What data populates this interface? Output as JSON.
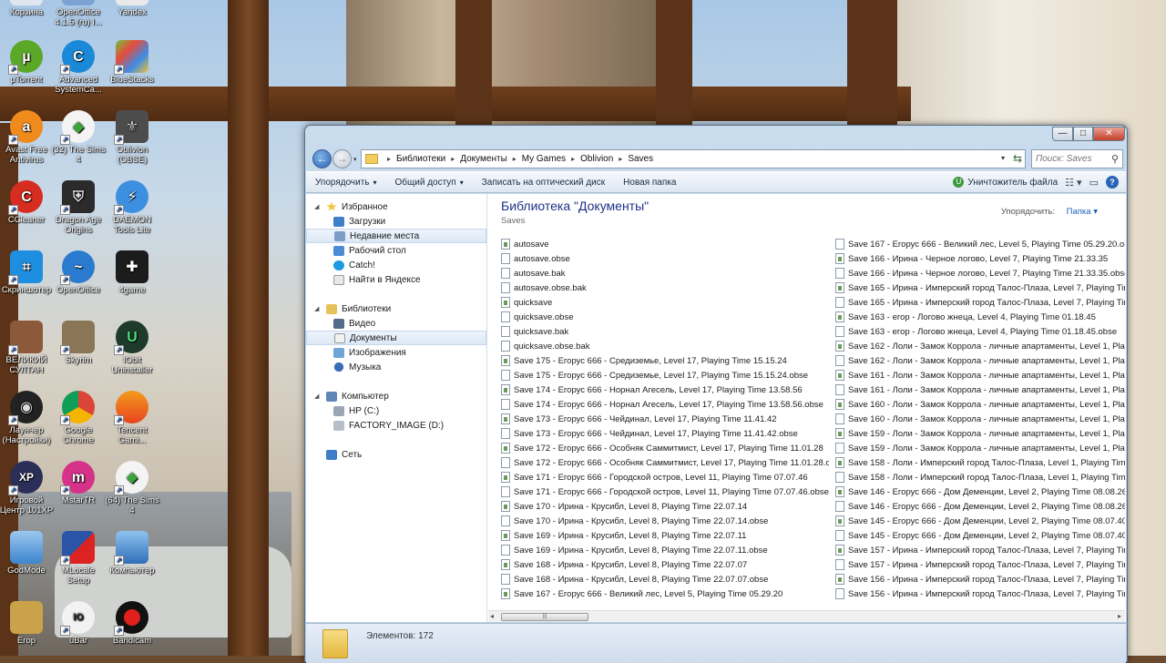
{
  "desktop": {
    "icons": [
      {
        "label": "Корзина"
      },
      {
        "label": "OpenOffice 4.1.5 (ru) I..."
      },
      {
        "label": "Yandex"
      },
      {
        "label": "µTorrent"
      },
      {
        "label": "Advanced SystemCa..."
      },
      {
        "label": "BlueStacks"
      },
      {
        "label": "Avast Free Antivirus"
      },
      {
        "label": "(32) The Sims 4"
      },
      {
        "label": "Oblivion (OBSE)"
      },
      {
        "label": "CCleaner"
      },
      {
        "label": "Dragon Age Origins"
      },
      {
        "label": "DAEMON Tools Lite"
      },
      {
        "label": "Скриншотер"
      },
      {
        "label": "OpenOffice"
      },
      {
        "label": "4game"
      },
      {
        "label": "ВЕЛИКИЙ СУЛТАН"
      },
      {
        "label": "Skyrim"
      },
      {
        "label": "IObit Uninstaller"
      },
      {
        "label": "Лаунчер (Настройки)"
      },
      {
        "label": "Google Chrome"
      },
      {
        "label": "Tencent Gami..."
      },
      {
        "label": "Игровой Центр 101XP"
      },
      {
        "label": "MstarTR"
      },
      {
        "label": "(64) The Sims 4"
      },
      {
        "label": "GodMode"
      },
      {
        "label": "MLocale Setup"
      },
      {
        "label": "Компьютер"
      },
      {
        "label": "Егор"
      },
      {
        "label": "uBar"
      },
      {
        "label": "Bandicam"
      }
    ]
  },
  "window": {
    "controls": {
      "minimize": "—",
      "maximize": "□",
      "close": "✕"
    },
    "address": {
      "crumbs": [
        "Библиотеки",
        "Документы",
        "My Games",
        "Oblivion",
        "Saves"
      ]
    },
    "search_placeholder": "Поиск: Saves",
    "toolbar": {
      "organize": "Упорядочить",
      "share": "Общий доступ",
      "burn": "Записать на оптический диск",
      "new_folder": "Новая папка",
      "delete_files": "Уничтожитель файла"
    },
    "nav": {
      "favorites": "Избранное",
      "downloads": "Загрузки",
      "recent": "Недавние места",
      "desktop": "Рабочий стол",
      "catch": "Catch!",
      "yandex": "Найти в Яндексе",
      "libraries": "Библиотеки",
      "video": "Видео",
      "documents": "Документы",
      "images": "Изображения",
      "music": "Музыка",
      "computer": "Компьютер",
      "drive_c": "HP (C:)",
      "drive_d": "FACTORY_IMAGE (D:)",
      "network": "Сеть"
    },
    "library": {
      "title": "Библиотека \"Документы\"",
      "subtitle": "Saves",
      "arrange_label": "Упорядочить:",
      "arrange_value": "Папка"
    },
    "files_col1": [
      {
        "name": "autosave",
        "save": true
      },
      {
        "name": "autosave.obse",
        "save": false
      },
      {
        "name": "autosave.bak",
        "save": false
      },
      {
        "name": "autosave.obse.bak",
        "save": false
      },
      {
        "name": "quicksave",
        "save": true
      },
      {
        "name": "quicksave.obse",
        "save": false
      },
      {
        "name": "quicksave.bak",
        "save": false
      },
      {
        "name": "quicksave.obse.bak",
        "save": false
      },
      {
        "name": "Save 175 - Егорус 666 - Средиземье, Level 17, Playing Time 15.15.24",
        "save": true
      },
      {
        "name": "Save 175 - Егорус 666 - Средиземье, Level 17, Playing Time 15.15.24.obse",
        "save": false
      },
      {
        "name": "Save 174 - Егорус 666 - Норнал Агесель, Level 17, Playing Time 13.58.56",
        "save": true
      },
      {
        "name": "Save 174 - Егорус 666 - Норнал Агесель, Level 17, Playing Time 13.58.56.obse",
        "save": false
      },
      {
        "name": "Save 173 - Егорус 666 - Чейдинал, Level 17, Playing Time 11.41.42",
        "save": true
      },
      {
        "name": "Save 173 - Егорус 666 - Чейдинал, Level 17, Playing Time 11.41.42.obse",
        "save": false
      },
      {
        "name": "Save 172 - Егорус 666 - Особняк Саммитмист, Level 17, Playing Time 11.01.28",
        "save": true
      },
      {
        "name": "Save 172 - Егорус 666 - Особняк Саммитмист, Level 17, Playing Time 11.01.28.obse",
        "save": false
      },
      {
        "name": "Save 171 - Егорус 666 - Городской остров, Level 11, Playing Time 07.07.46",
        "save": true
      },
      {
        "name": "Save 171 - Егорус 666 - Городской остров, Level 11, Playing Time 07.07.46.obse",
        "save": false
      },
      {
        "name": "Save 170 - Ирина - Крусибл, Level 8, Playing Time 22.07.14",
        "save": true
      },
      {
        "name": "Save 170 - Ирина - Крусибл, Level 8, Playing Time 22.07.14.obse",
        "save": false
      },
      {
        "name": "Save 169 - Ирина - Крусибл, Level 8, Playing Time 22.07.11",
        "save": true
      },
      {
        "name": "Save 169 - Ирина - Крусибл, Level 8, Playing Time 22.07.11.obse",
        "save": false
      },
      {
        "name": "Save 168 - Ирина - Крусибл, Level 8, Playing Time 22.07.07",
        "save": true
      },
      {
        "name": "Save 168 - Ирина - Крусибл, Level 8, Playing Time 22.07.07.obse",
        "save": false
      },
      {
        "name": "Save 167 - Егорус 666 - Великий лес, Level 5, Playing Time 05.29.20",
        "save": true
      }
    ],
    "files_col2": [
      {
        "name": "Save 167 - Егорус 666 - Великий лес, Level 5, Playing Time 05.29.20.obse",
        "save": false
      },
      {
        "name": "Save 166 - Ирина - Черное логово, Level 7, Playing Time 21.33.35",
        "save": true
      },
      {
        "name": "Save 166 - Ирина - Черное логово, Level 7, Playing Time 21.33.35.obse",
        "save": false
      },
      {
        "name": "Save 165 - Ирина - Имперский город Талос-Плаза, Level 7, Playing Time",
        "save": true
      },
      {
        "name": "Save 165 - Ирина - Имперский город Талос-Плаза, Level 7, Playing Time",
        "save": false
      },
      {
        "name": "Save 163 - егор - Логово жнеца, Level 4, Playing Time 01.18.45",
        "save": true
      },
      {
        "name": "Save 163 - егор - Логово жнеца, Level 4, Playing Time 01.18.45.obse",
        "save": false
      },
      {
        "name": "Save 162 - Лоли - Замок Коррола - личные апартаменты, Level 1, Playing",
        "save": true
      },
      {
        "name": "Save 162 - Лоли - Замок Коррола - личные апартаменты, Level 1, Playing",
        "save": false
      },
      {
        "name": "Save 161 - Лоли - Замок Коррола - личные апартаменты, Level 1, Playing",
        "save": true
      },
      {
        "name": "Save 161 - Лоли - Замок Коррола - личные апартаменты, Level 1, Playing",
        "save": false
      },
      {
        "name": "Save 160 - Лоли - Замок Коррола - личные апартаменты, Level 1, Playing",
        "save": true
      },
      {
        "name": "Save 160 - Лоли - Замок Коррола - личные апартаменты, Level 1, Playing",
        "save": false
      },
      {
        "name": "Save 159 - Лоли - Замок Коррола - личные апартаменты, Level 1, Playing",
        "save": true
      },
      {
        "name": "Save 159 - Лоли - Замок Коррола - личные апартаменты, Level 1, Playing",
        "save": false
      },
      {
        "name": "Save 158 - Лоли - Имперский город Талос-Плаза, Level 1, Playing Time 0",
        "save": true
      },
      {
        "name": "Save 158 - Лоли - Имперский город Талос-Плаза, Level 1, Playing Time 0",
        "save": false
      },
      {
        "name": "Save 146 - Егорус 666 - Дом Деменции, Level 2, Playing Time 08.08.26",
        "save": true
      },
      {
        "name": "Save 146 - Егорус 666 - Дом Деменции, Level 2, Playing Time 08.08.26.obse",
        "save": false
      },
      {
        "name": "Save 145 - Егорус 666 - Дом Деменции, Level 2, Playing Time 08.07.40",
        "save": true
      },
      {
        "name": "Save 145 - Егорус 666 - Дом Деменции, Level 2, Playing Time 08.07.40.obse",
        "save": false
      },
      {
        "name": "Save 157 - Ирина - Имперский город Талос-Плаза, Level 7, Playing Time",
        "save": true
      },
      {
        "name": "Save 157 - Ирина - Имперский город Талос-Плаза, Level 7, Playing Time",
        "save": false
      },
      {
        "name": "Save 156 - Ирина - Имперский город Талос-Плаза, Level 7, Playing Time",
        "save": true
      },
      {
        "name": "Save 156 - Ирина - Имперский город Талос-Плаза, Level 7, Playing Time",
        "save": false
      }
    ],
    "status": {
      "count_text": "Элементов: 172"
    }
  }
}
